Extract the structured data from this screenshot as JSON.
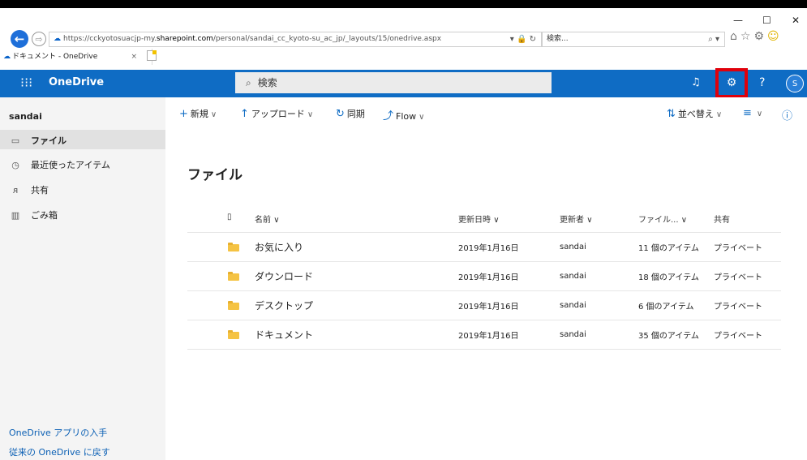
{
  "browser": {
    "url_prefix": "https://cckyotosuacjp-my.",
    "url_host": "sharepoint.com",
    "url_path": "/personal/sandai_cc_kyoto-su_ac_jp/_layouts/15/onedrive.aspx",
    "address_tools": "▾ 🔒 ↻",
    "search_placeholder": "検索...",
    "search_icon": "⌕ ▾",
    "tab_title": "ドキュメント - OneDrive",
    "tab_close": "×",
    "minimize": "—",
    "maximize": "☐",
    "close": "✕"
  },
  "appbar": {
    "brand": "OneDrive",
    "search_placeholder": "検索",
    "accent": "#0f6cc4",
    "highlight": "#e0000b",
    "avatar_initial": "S"
  },
  "sidebar": {
    "user": "sandai",
    "items": [
      {
        "label": "ファイル",
        "icon": "folder-icon"
      },
      {
        "label": "最近使ったアイテム",
        "icon": "clock-icon"
      },
      {
        "label": "共有",
        "icon": "people-icon"
      },
      {
        "label": "ごみ箱",
        "icon": "trash-icon"
      }
    ],
    "footer_links": [
      "OneDrive アプリの入手",
      "従来の OneDrive に戻す"
    ]
  },
  "commands": {
    "new": "新規",
    "upload": "アップロード",
    "sync": "同期",
    "flow": "Flow",
    "sort": "並べ替え"
  },
  "main": {
    "title": "ファイル",
    "columns": {
      "name": "名前",
      "modified": "更新日時",
      "modified_by": "更新者",
      "size": "ファイル...",
      "sharing": "共有"
    },
    "rows": [
      {
        "name": "お気に入り",
        "modified": "2019年1月16日",
        "modified_by": "sandai",
        "size": "11 個のアイテム",
        "sharing": "プライベート"
      },
      {
        "name": "ダウンロード",
        "modified": "2019年1月16日",
        "modified_by": "sandai",
        "size": "18 個のアイテム",
        "sharing": "プライベート"
      },
      {
        "name": "デスクトップ",
        "modified": "2019年1月16日",
        "modified_by": "sandai",
        "size": "6 個のアイテム",
        "sharing": "プライベート"
      },
      {
        "name": "ドキュメント",
        "modified": "2019年1月16日",
        "modified_by": "sandai",
        "size": "35 個のアイテム",
        "sharing": "プライベート"
      }
    ]
  }
}
